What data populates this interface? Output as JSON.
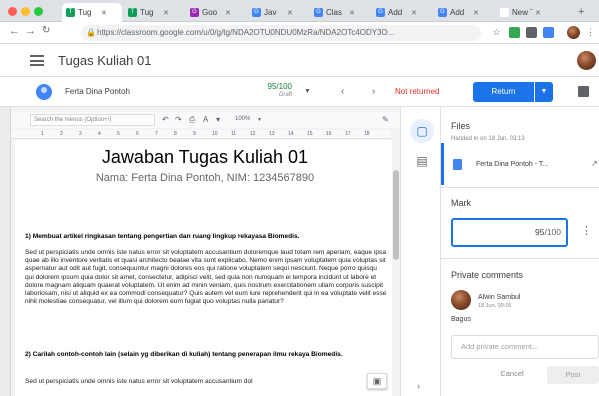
{
  "browser": {
    "window_dots": [
      "#ff5f56",
      "#ffbd2e",
      "#27c93f"
    ],
    "tabs": [
      {
        "label": "Tug",
        "icon": "sheets-icon",
        "color": "#0f9d58",
        "glyph": "T"
      },
      {
        "label": "Tug",
        "icon": "sheets-icon",
        "color": "#0f9d58",
        "glyph": "T"
      },
      {
        "label": "Goo",
        "icon": "classroom-icon",
        "color": "#9c27b0",
        "glyph": "G"
      },
      {
        "label": "Jav",
        "icon": "google-icon",
        "color": "#4285f4",
        "glyph": "G"
      },
      {
        "label": "Clas",
        "icon": "google-icon",
        "color": "#4285f4",
        "glyph": "G"
      },
      {
        "label": "Add",
        "icon": "google-icon",
        "color": "#4285f4",
        "glyph": "G"
      },
      {
        "label": "Add",
        "icon": "google-icon",
        "color": "#4285f4",
        "glyph": "G"
      },
      {
        "label": "New Tab",
        "icon": "blank-icon",
        "color": "#ffffff",
        "glyph": ""
      }
    ],
    "new_tab": "+",
    "url": "https://classroom.google.com/u/0/g/tg/NDA2OTU0NDU0MzRa/NDA2OTc4ODY3O..."
  },
  "header": {
    "title": "Tugas Kuliah 01"
  },
  "student_bar": {
    "student_name": "Ferta Dina Pontoh",
    "grade": "95/100",
    "grade_status": "Draft",
    "status": "Not returned",
    "return_button": "Return",
    "accent": "#1a73e8",
    "status_color": "#d93025"
  },
  "doc": {
    "search_placeholder": "Search the menus (Option+/)",
    "zoom": "100%",
    "ruler": [
      "1",
      "2",
      "3",
      "4",
      "5",
      "6",
      "7",
      "8",
      "9",
      "10",
      "11",
      "12",
      "13",
      "14",
      "15",
      "16",
      "17",
      "18"
    ],
    "title": "Jawaban Tugas Kuliah 01",
    "subtitle": "Nama: Ferta Dina Pontoh, NIM: 1234567890",
    "q1": "1) Membuat artikel ringkasan tentang pengertian dan ruang lingkup rekayasa Biomedis.",
    "p1": "Sed ut perspiciatis unde omnis iste natus error sit voluptatem accusantium doloremque laud totam rem aperiam, eaque ipsa quae ab illo inventore veritatis et quasi architecto beatae vita sunt explicabo. Nemo enim ipsam voluptatem quia voluptas sit aspernatur aut odit aut fugit, consequuntur magni dolores eos qui ratione voluptatem sequi nesciunt. Neque porro quisqu qui dolorem ipsum quia dolor sit amet, consectetur, adipisci velit, sed quia non numquam ei tempora incidunt ut labore et dolore magnam aliquam quaerat voluptatem. Ut enim ad minin veniam, quis nostrum exercitationem ullam corporis suscipit laboriosam, nisi ut aliquid ex ea commodi consequatur? Quis autem vel eum iure reprehenderit qui in ea voluptate velit esse nihil molestiae consequatur, vel illum qui dolorem eum fugiat quo voluptas nulla pariatur?",
    "q2": "2) Carilah contoh-contoh lain (selain yg diberikan di kuliah) tentang penerapan ilmu rekaya Biomedis.",
    "p2": "Sed ut perspiciatis unde omnis iste natus error sit voluptatem accusantium dol"
  },
  "panel": {
    "files_heading": "Files",
    "handed_in": "Handed in on 18 Jun, 03:13",
    "file_name": "Ferta Dina Pontoh - T...",
    "mark_heading": "Mark",
    "mark_value": "95",
    "mark_denominator": "/100",
    "comments_heading": "Private comments",
    "commenter": "Alwin Sambul",
    "comment_date": "18 Jun, 00:16",
    "comment_text": "Bagus",
    "comment_placeholder": "Add private comment...",
    "cancel": "Cancel",
    "post": "Post"
  }
}
